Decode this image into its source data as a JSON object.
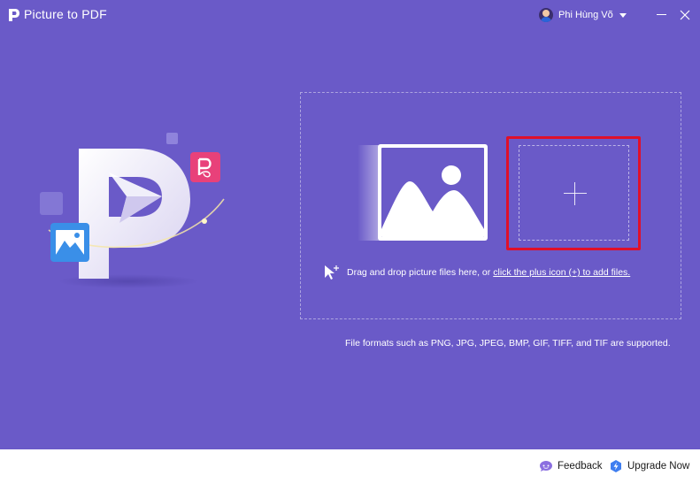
{
  "app": {
    "title": "Picture to PDF",
    "accent": "#6a5ac8",
    "highlight": "#e0102a"
  },
  "user": {
    "name": "Phi Hùng Võ"
  },
  "window_controls": {
    "minimize_icon": "minimize-icon",
    "close_icon": "close-icon"
  },
  "dropzone": {
    "hint_text": "Drag and drop picture files here, or",
    "hint_link": "click the plus icon (+) to add files.",
    "plus_icon": "plus-icon",
    "picture_icon": "image-icon"
  },
  "formats_note": "File formats such as PNG, JPG, JPEG, BMP, GIF, TIFF, and TIF are supported.",
  "footer": {
    "feedback_label": "Feedback",
    "upgrade_label": "Upgrade Now"
  }
}
